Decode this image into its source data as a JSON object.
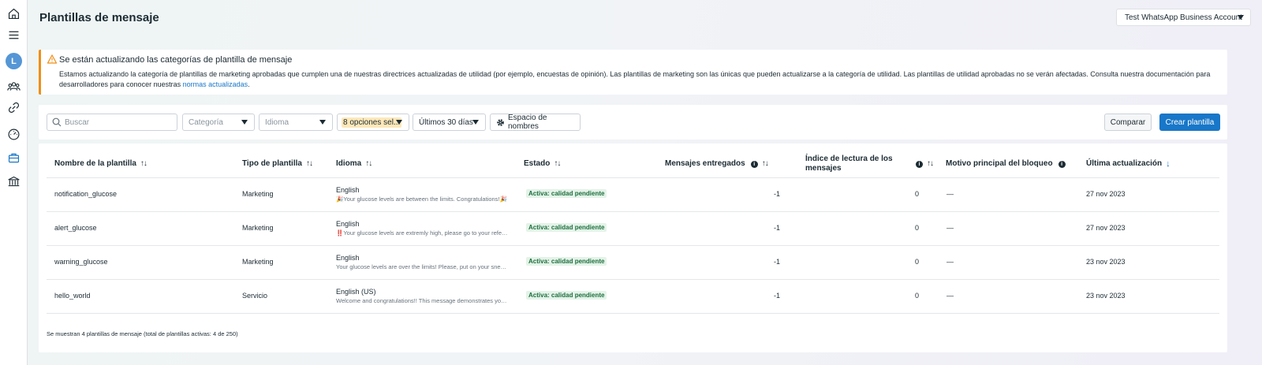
{
  "page": {
    "title": "Plantillas de mensaje",
    "account": "Test WhatsApp Business Account"
  },
  "rail": {
    "avatar_letter": "L"
  },
  "banner": {
    "title": "Se están actualizando las categorías de plantilla de mensaje",
    "body": "Estamos actualizando la categoría de plantillas de marketing aprobadas que cumplen una de nuestras directrices actualizadas de utilidad (por ejemplo, encuestas de opinión). Las plantillas de marketing son las únicas que pueden actualizarse a la categoría de utilidad. Las plantillas de utilidad aprobadas no se verán afectadas. Consulta nuestra documentación para desarrolladores para conocer nuestras ",
    "link": "normas actualizadas",
    "tail": "."
  },
  "filters": {
    "search_placeholder": "Buscar",
    "category": "Categoría",
    "language": "Idioma",
    "status": "8 opciones sel...",
    "date": "Últimos 30 días",
    "namespace": "Espacio de nombres",
    "compare": "Comparar",
    "create": "Crear plantilla"
  },
  "table": {
    "headers": {
      "name": "Nombre de la plantilla",
      "type": "Tipo de plantilla",
      "language": "Idioma",
      "status": "Estado",
      "delivered": "Mensajes entregados",
      "read_rate_1": "Índice de lectura de los",
      "read_rate_2": "mensajes",
      "block_reason": "Motivo principal del bloqueo",
      "updated": "Última actualización"
    },
    "rows": [
      {
        "name": "notification_glucose",
        "type": "Marketing",
        "lang": "English",
        "preview": "🎉Your glucose levels are between the limits. Congratulations!🎉",
        "status": "Activa: calidad pendiente",
        "delivered": "-1",
        "read": "0",
        "block": "—",
        "updated": "27 nov 2023"
      },
      {
        "name": "alert_glucose",
        "type": "Marketing",
        "lang": "English",
        "preview": "‼️Your glucose levels are extremly high, please go to your referen...",
        "status": "Activa: calidad pendiente",
        "delivered": "-1",
        "read": "0",
        "block": "—",
        "updated": "27 nov 2023"
      },
      {
        "name": "warning_glucose",
        "type": "Marketing",
        "lang": "English",
        "preview": "Your glucose levels are over the limits! Please, put on your sneak...",
        "status": "Activa: calidad pendiente",
        "delivered": "-1",
        "read": "0",
        "block": "—",
        "updated": "23 nov 2023"
      },
      {
        "name": "hello_world",
        "type": "Servicio",
        "lang": "English (US)",
        "preview": "Welcome and congratulations!! This message demonstrates your...",
        "status": "Activa: calidad pendiente",
        "delivered": "-1",
        "read": "0",
        "block": "—",
        "updated": "23 nov 2023"
      }
    ],
    "footer": "Se muestran 4 plantillas de mensaje (total de plantillas activas: 4 de 250)"
  },
  "colors": {
    "primary": "#1877c8",
    "warning": "#f08f17",
    "active_badge": "#e4f3e8"
  }
}
